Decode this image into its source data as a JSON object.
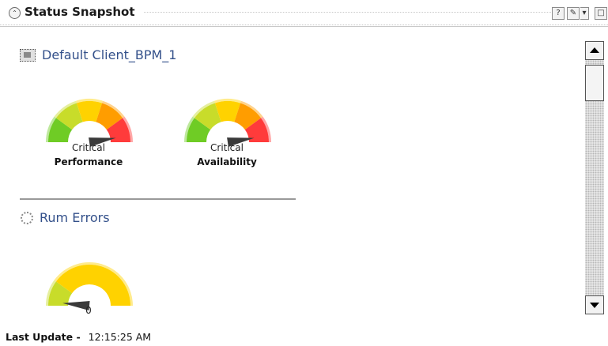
{
  "header": {
    "title": "Status Snapshot",
    "collapse_glyph": "⌃",
    "help_glyph": "?",
    "edit_glyph": "✎",
    "menu_glyph": "▾",
    "maximize_glyph": "□"
  },
  "sections": [
    {
      "title": "Default Client_BPM_1",
      "icon": "client-icon",
      "gauges": [
        {
          "status": "Critical",
          "name": "Performance",
          "level": 0.95
        },
        {
          "status": "Critical",
          "name": "Availability",
          "level": 0.95
        }
      ]
    },
    {
      "title": "Rum Errors",
      "icon": "loading-icon",
      "gauges": [
        {
          "value": "0",
          "level": 0.03
        }
      ]
    }
  ],
  "footer": {
    "label": "Last Update -",
    "time": "12:15:25 AM"
  },
  "colors": {
    "green": "#6fcc25",
    "yellowgreen": "#c8dc2a",
    "yellow": "#ffd200",
    "orange": "#ff9d00",
    "red": "#ff3b3b",
    "title_blue": "#33508a"
  }
}
